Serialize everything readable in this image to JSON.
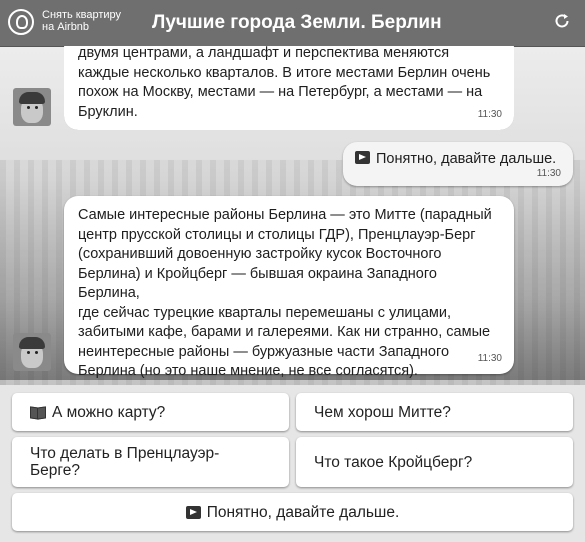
{
  "header": {
    "brand_line1": "Снять квартиру",
    "brand_line2": "на Airbnb",
    "title": "Лучшие города Земли. Берлин"
  },
  "messages": [
    {
      "lines": [
        "двумя центрами, а ландшафт и перспектива меняются",
        "каждые несколько кварталов. В итоге местами Берлин очень",
        "похож на Москву, местами — на Петербург, а местами — на",
        "Бруклин."
      ],
      "time": "11:30"
    },
    {
      "text": "Понятно, давайте дальше.",
      "time": "11:30"
    },
    {
      "lines": [
        "Самые интересные районы Берлина — это Митте (парадный",
        "центр прусской столицы и столицы ГДР), Пренцлауэр-Берг",
        "(сохранивший довоенную застройку кусок Восточного",
        "Берлина) и Кройцберг — бывшая окраина Западного Берлина,",
        "где сейчас турецкие кварталы перемешаны с улицами,",
        "забитыми кафе, барами и галереями. Как ни странно, самые",
        "неинтересные районы — буржуазные части Западного",
        "Берлина (но это наше мнение, не все согласятся)."
      ],
      "time": "11:30"
    }
  ],
  "buttons": {
    "map": "А можно карту?",
    "mitte": "Чем хорош Митте?",
    "prenz_line1": "Что делать в Пренцлауэр-",
    "prenz_line2": "Берге?",
    "kreuz": "Что такое Кройцберг?",
    "next": "Понятно, давайте дальше."
  }
}
